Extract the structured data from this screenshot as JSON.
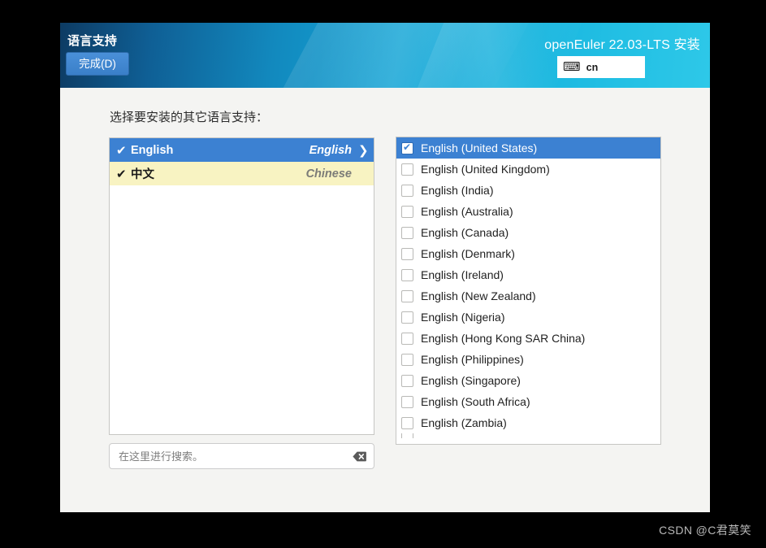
{
  "header": {
    "spoke_title": "语言支持",
    "done_label": "完成(D)",
    "product_title": "openEuler 22.03-LTS 安装",
    "keyboard_icon": "keyboard-icon",
    "keyboard_layout": "cn"
  },
  "content": {
    "instruction": "选择要安装的其它语言支持："
  },
  "language_list": [
    {
      "check": "✔",
      "native": "English",
      "english": "English",
      "chevron": "❯",
      "state": "selected"
    },
    {
      "check": "✔",
      "native": "中文",
      "english": "Chinese",
      "chevron": "",
      "state": "highlight"
    }
  ],
  "search": {
    "placeholder": "在这里进行搜索。",
    "value": "",
    "clear_icon": "clear-backspace-icon"
  },
  "locale_list": [
    {
      "label": "English (United States)",
      "checked": true
    },
    {
      "label": "English (United Kingdom)",
      "checked": false
    },
    {
      "label": "English (India)",
      "checked": false
    },
    {
      "label": "English (Australia)",
      "checked": false
    },
    {
      "label": "English (Canada)",
      "checked": false
    },
    {
      "label": "English (Denmark)",
      "checked": false
    },
    {
      "label": "English (Ireland)",
      "checked": false
    },
    {
      "label": "English (New Zealand)",
      "checked": false
    },
    {
      "label": "English (Nigeria)",
      "checked": false
    },
    {
      "label": "English (Hong Kong SAR China)",
      "checked": false
    },
    {
      "label": "English (Philippines)",
      "checked": false
    },
    {
      "label": "English (Singapore)",
      "checked": false
    },
    {
      "label": "English (South Africa)",
      "checked": false
    },
    {
      "label": "English (Zambia)",
      "checked": false
    }
  ],
  "watermark": "CSDN @C君莫笑",
  "colors": {
    "accent_blue": "#3c81d2",
    "highlight_yellow": "#f8f3c2",
    "header_dark": "#0d3b63",
    "header_cyan": "#2ec8e8",
    "window_bg": "#f4f4f2"
  }
}
